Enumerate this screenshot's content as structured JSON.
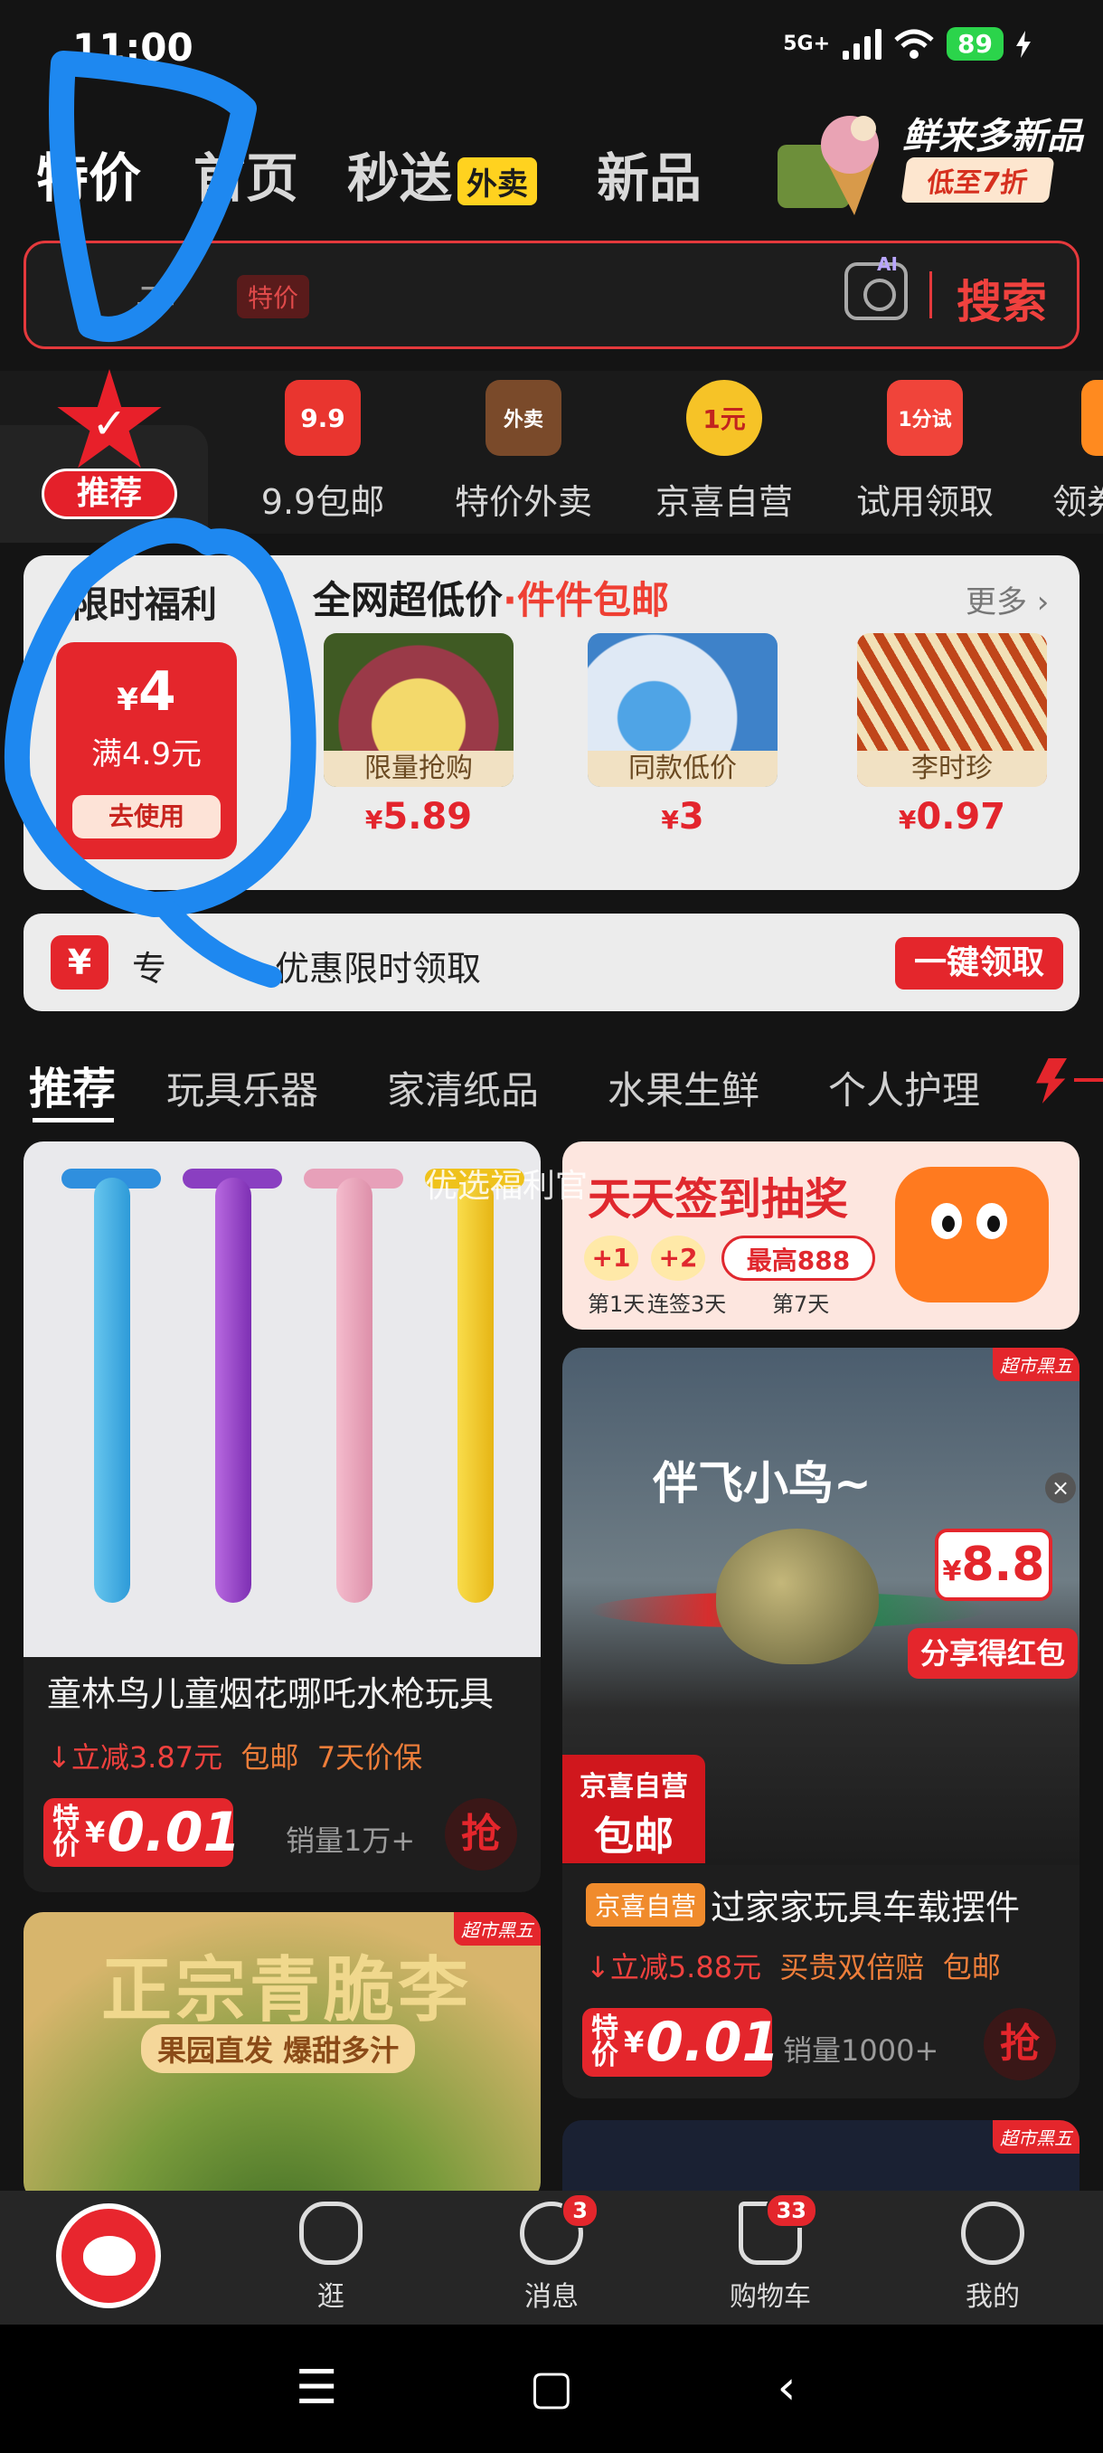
{
  "status_bar": {
    "time": "11:00",
    "network": "5G+",
    "battery": "89"
  },
  "top_tabs": [
    {
      "label": "特价",
      "active": true
    },
    {
      "label": "首页"
    },
    {
      "label": "秒送",
      "badge": "外卖"
    },
    {
      "label": "新品"
    }
  ],
  "promo": {
    "title": "鲜来多新品",
    "subtitle": "低至7折"
  },
  "search": {
    "placeholder": "子",
    "tag": "特价",
    "ai": "AI",
    "button": "搜索"
  },
  "categories": [
    {
      "label": "推荐",
      "icon": "check-star-icon",
      "active": true
    },
    {
      "label": "9.9包邮",
      "icon": "9.9"
    },
    {
      "label": "特价外卖",
      "icon": "外卖"
    },
    {
      "label": "京喜自营",
      "icon": "1元"
    },
    {
      "label": "试用领取",
      "icon": "1分试"
    },
    {
      "label": "领券"
    }
  ],
  "welfare": {
    "title": "限时福利",
    "coupon": {
      "currency": "¥",
      "amount": "4",
      "condition": "满4.9元",
      "button": "去使用"
    },
    "lowprice_title": "全网超低价",
    "lowprice_sub": "·件件包邮",
    "more": "更多",
    "deals": [
      {
        "tag": "限量抢购",
        "currency": "¥",
        "price": "5.89"
      },
      {
        "tag": "同款低价",
        "currency": "¥",
        "price": "3"
      },
      {
        "tag": "李时珍",
        "currency": "¥",
        "price": "0.97"
      }
    ]
  },
  "coupon_banner": {
    "icon": "¥",
    "text_a": "专",
    "text_b": "优惠限时领取",
    "button": "一键领取"
  },
  "feed_tabs": [
    "推荐",
    "玩具乐器",
    "家清纸品",
    "水果生鲜",
    "个人护理"
  ],
  "products": {
    "water_gun": {
      "title": "童林鸟儿童烟花哪吒水枪玩具",
      "cut": "立减3.87元",
      "ship": "包邮",
      "guard": "7天价保",
      "price_tag": "特价",
      "currency": "¥",
      "price": "0.01",
      "sales": "销量1万+",
      "grab": "抢"
    },
    "signin": {
      "watermark": "优选福利官",
      "title": "天天签到抽奖",
      "chips": [
        "+1",
        "+2",
        "最高888"
      ],
      "captions": [
        "第1天",
        "连签3天",
        "第7天"
      ]
    },
    "bird": {
      "corner": "超市黑五",
      "caption": "伴飞小鸟~",
      "hb_currency": "¥",
      "hb_amount": "8.8",
      "hb_share": "分享得红包",
      "jx_line1": "京喜自营",
      "jx_line2": "包邮",
      "tag": "京喜自营",
      "title": "过家家玩具车载摆件",
      "cut": "立减5.88元",
      "guard": "买贵双倍赔",
      "ship": "包邮",
      "price_tag": "特价",
      "currency": "¥",
      "price": "0.01",
      "sales": "销量1000+",
      "grab": "抢"
    },
    "plum": {
      "corner": "超市黑五",
      "title": "正宗青脆李",
      "subtitle": "果园直发 爆甜多汁"
    },
    "dark_card": {
      "corner": "超市黑五"
    }
  },
  "bottom_nav": [
    {
      "label": "",
      "icon": "jd-mascot-icon"
    },
    {
      "label": "逛",
      "icon": "stroll-icon"
    },
    {
      "label": "消息",
      "icon": "message-icon",
      "badge": "3"
    },
    {
      "label": "购物车",
      "icon": "cart-icon",
      "badge": "33"
    },
    {
      "label": "我的",
      "icon": "user-icon"
    }
  ],
  "colors": {
    "accent": "#e4262c",
    "background": "#141414",
    "annotation": "#1e88f0"
  }
}
